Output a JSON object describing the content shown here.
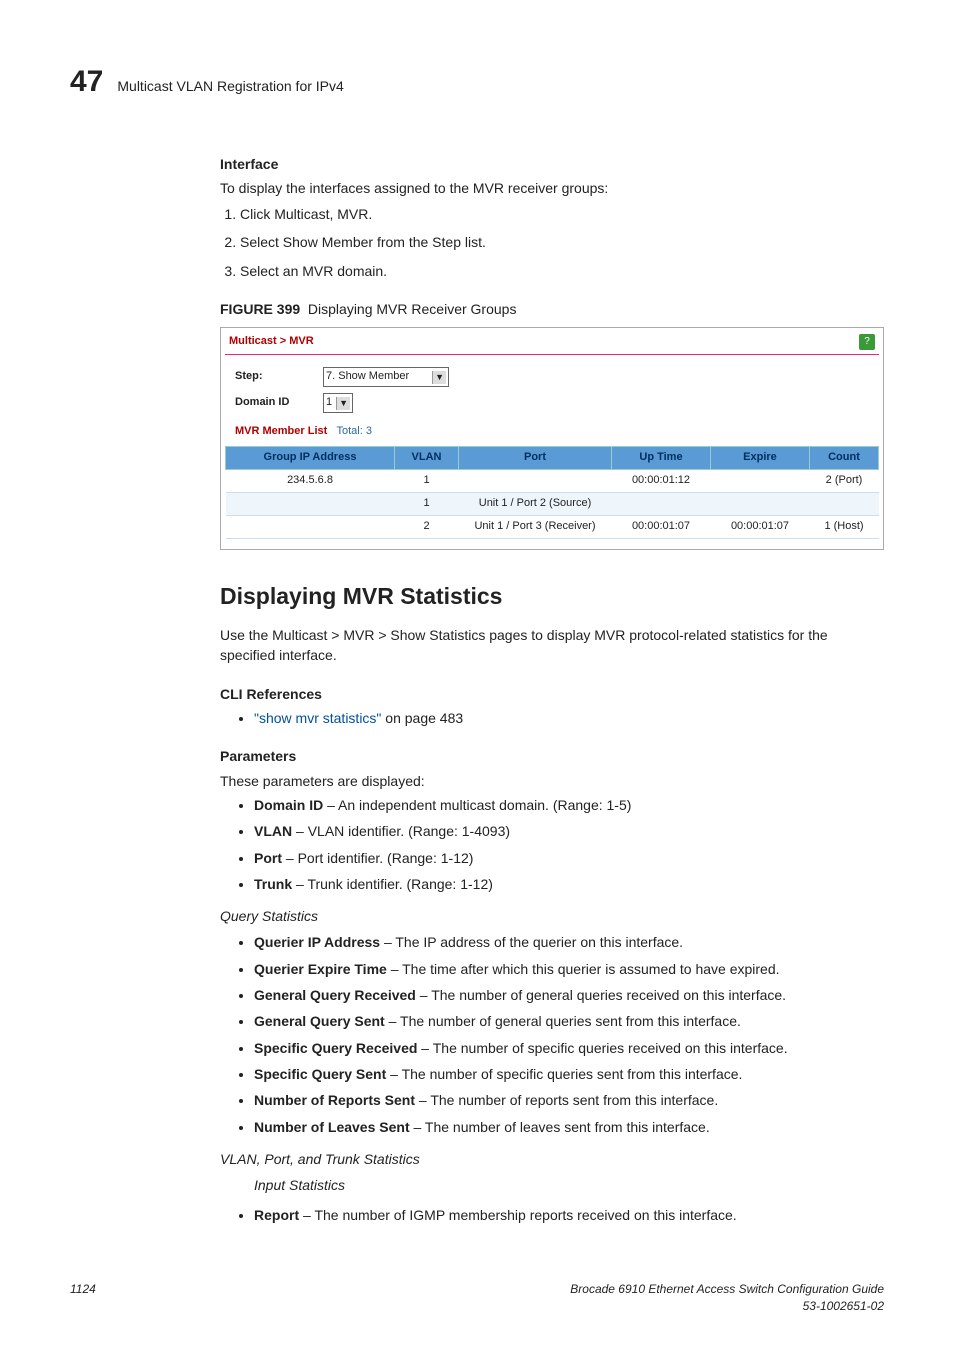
{
  "header": {
    "chapter_number": "47",
    "chapter_title": "Multicast VLAN Registration for IPv4"
  },
  "interface": {
    "heading": "Interface",
    "intro": "To display the interfaces assigned to the MVR receiver groups:",
    "steps": [
      "Click Multicast, MVR.",
      "Select Show Member from the Step list.",
      "Select an MVR domain."
    ]
  },
  "figure": {
    "label": "FIGURE 399",
    "caption": "Displaying MVR Receiver Groups"
  },
  "screenshot": {
    "breadcrumb": "Multicast > MVR",
    "help_symbol": "?",
    "step_label": "Step:",
    "step_value": "7. Show Member",
    "domain_label": "Domain ID",
    "domain_value": "1",
    "list_title": "MVR Member List",
    "list_total": "Total: 3",
    "columns": [
      "Group IP Address",
      "VLAN",
      "Port",
      "Up Time",
      "Expire",
      "Count"
    ],
    "rows": [
      [
        "234.5.6.8",
        "1",
        "",
        "00:00:01:12",
        "",
        "2 (Port)"
      ],
      [
        "",
        "1",
        "Unit 1 / Port 2 (Source)",
        "",
        "",
        ""
      ],
      [
        "",
        "2",
        "Unit 1 / Port 3 (Receiver)",
        "00:00:01:07",
        "00:00:01:07",
        "1 (Host)"
      ]
    ]
  },
  "stats": {
    "title": "Displaying MVR Statistics",
    "intro": "Use the Multicast > MVR > Show Statistics pages to display MVR protocol-related statistics for the specified interface.",
    "cli_heading": "CLI References",
    "cli_link": "\"show mvr statistics\"",
    "cli_suffix": " on page 483",
    "params_heading": "Parameters",
    "params_intro": "These parameters are displayed:",
    "basic_params": [
      {
        "term": "Domain ID",
        "desc": " – An independent multicast domain. (Range: 1-5)"
      },
      {
        "term": "VLAN",
        "desc": " – VLAN identifier. (Range: 1-4093)"
      },
      {
        "term": "Port",
        "desc": " – Port identifier. (Range: 1-12)"
      },
      {
        "term": "Trunk",
        "desc": " – Trunk identifier. (Range: 1-12)"
      }
    ],
    "query_heading": "Query Statistics",
    "query_params": [
      {
        "term": "Querier IP Address",
        "desc": " – The IP address of the querier on this interface."
      },
      {
        "term": "Querier Expire Time",
        "desc": " – The time after which this querier is assumed to have expired."
      },
      {
        "term": "General Query Received",
        "desc": " – The number of general queries received on this interface."
      },
      {
        "term": "General Query Sent",
        "desc": " – The number of general queries sent from this interface."
      },
      {
        "term": "Specific Query Received",
        "desc": " – The number of specific queries received on this interface."
      },
      {
        "term": "Specific Query Sent",
        "desc": " – The number of specific queries sent from this interface."
      },
      {
        "term": "Number of Reports Sent",
        "desc": " – The number of reports sent from this interface."
      },
      {
        "term": "Number of Leaves Sent",
        "desc": " – The number of leaves sent from this interface."
      }
    ],
    "vpt_heading": "VLAN, Port, and Trunk Statistics",
    "input_heading": "Input Statistics",
    "input_params": [
      {
        "term": "Report",
        "desc": " – The number of IGMP membership reports received on this interface."
      }
    ]
  },
  "footer": {
    "page": "1124",
    "doc_title": "Brocade 6910 Ethernet Access Switch Configuration Guide",
    "doc_num": "53-1002651-02"
  }
}
